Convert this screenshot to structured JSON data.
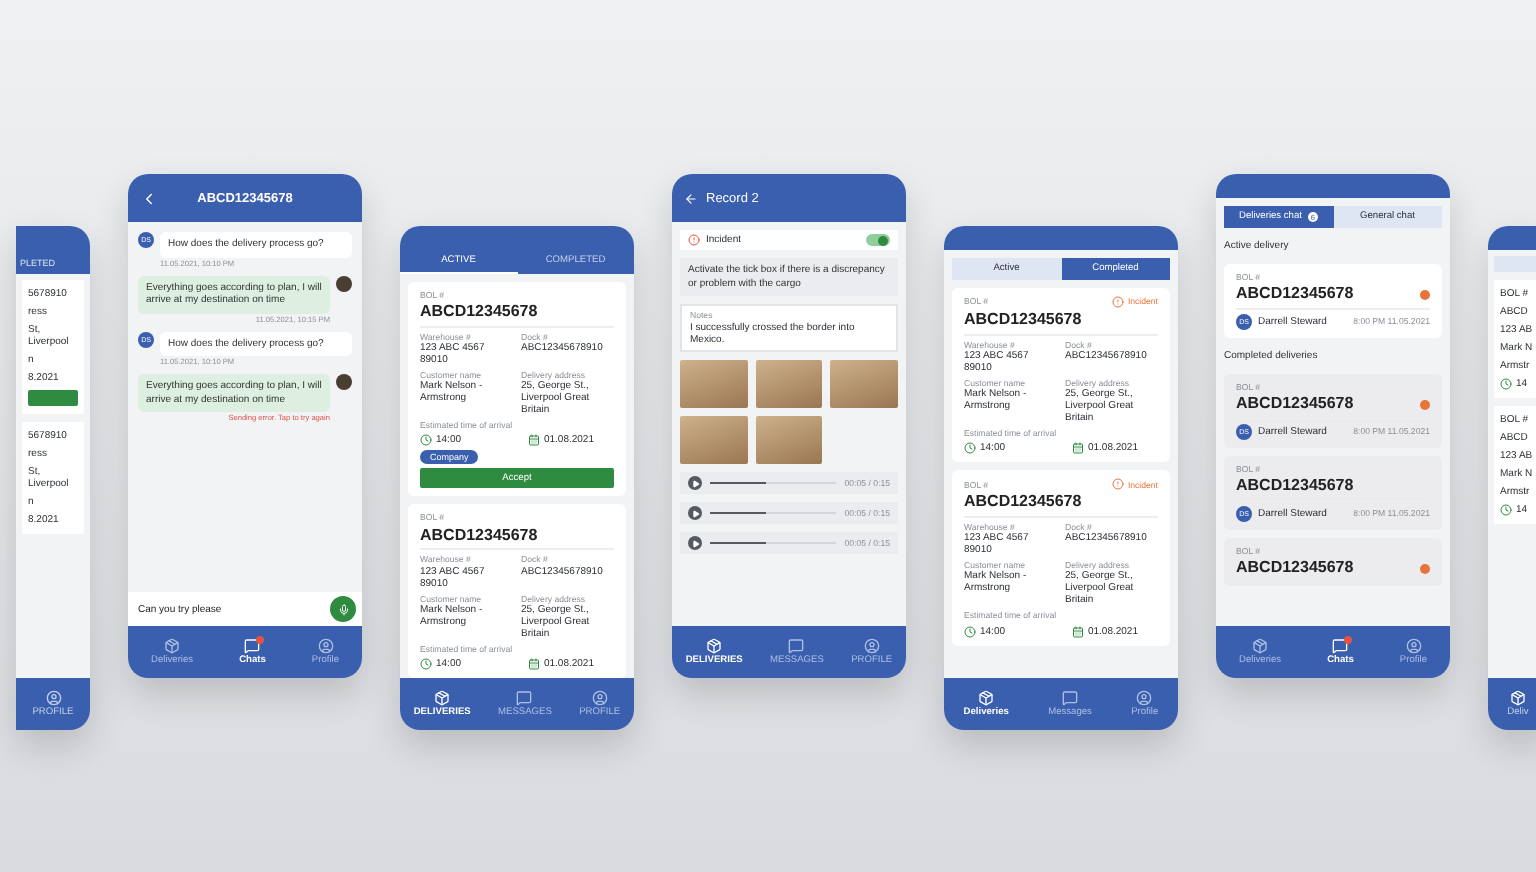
{
  "screens": [
    {
      "kind": "partial_left",
      "tab": "PLETED",
      "cards": [
        {
          "lines": [
            "5678910",
            "ress",
            "St, Liverpool",
            "n",
            "8.2021"
          ],
          "button": true
        },
        {
          "lines": [
            "5678910",
            "ress",
            "St, Liverpool",
            "n",
            "8.2021"
          ],
          "button": false
        }
      ],
      "nav_label": "PROFILE"
    },
    {
      "kind": "chat",
      "title": "ABCD12345678",
      "messages": [
        {
          "kind": "incoming",
          "initials": "DS",
          "text": "How does the delivery process go?",
          "time": "11.05.2021, 10:10 PM",
          "error": false
        },
        {
          "kind": "outgoing",
          "text": "Everything goes according to plan, I will arrive at my destination on time",
          "time": "11.05.2021, 10:15 PM",
          "error": false
        },
        {
          "kind": "incoming",
          "initials": "DS",
          "text": "How does the delivery process go?",
          "time": "11.05.2021, 10:10 PM",
          "error": false
        },
        {
          "kind": "outgoing",
          "text": "Everything goes according to plan, I will arrive at my destination on time",
          "time": "Sending error. Tap to try again",
          "error": true
        }
      ],
      "input": "Can you try please",
      "nav": [
        {
          "label": "Deliveries",
          "selected": false,
          "badge": false
        },
        {
          "label": "Chats",
          "selected": true,
          "badge": true
        },
        {
          "label": "Profile",
          "selected": false,
          "badge": false
        }
      ]
    },
    {
      "kind": "deliveries",
      "tabs": [
        {
          "label": "ACTIVE",
          "selected": true
        },
        {
          "label": "COMPLETED",
          "selected": false
        }
      ],
      "cards": [
        {
          "bol_label": "BOL #",
          "bol": "ABCD12345678",
          "fields": [
            {
              "label": "Warehouse #",
              "value": "123 ABC 4567 89010"
            },
            {
              "label": "Dock #",
              "value": "ABC12345678910"
            },
            {
              "label": "Customer name",
              "value": "Mark Nelson - Armstrong"
            },
            {
              "label": "Delivery address",
              "value": "25, George St., Liverpool Great Britain"
            }
          ],
          "eta_label": "Estimated time of arrival",
          "time": "14:00",
          "date": "01.08.2021",
          "tag": "Company",
          "button": "Accept"
        },
        {
          "bol_label": "BOL #",
          "bol": "ABCD12345678",
          "fields": [
            {
              "label": "Warehouse #",
              "value": "123 ABC 4567 89010"
            },
            {
              "label": "Dock #",
              "value": "ABC12345678910"
            },
            {
              "label": "Customer name",
              "value": "Mark Nelson - Armstrong"
            },
            {
              "label": "Delivery address",
              "value": "25, George St., Liverpool Great Britain"
            }
          ],
          "eta_label": "Estimated time of arrival",
          "time": "14:00",
          "date": "01.08.2021"
        }
      ],
      "nav": [
        {
          "label": "DELIVERIES",
          "selected": true,
          "badge": false
        },
        {
          "label": "MESSAGES",
          "selected": false,
          "badge": false
        },
        {
          "label": "PROFILE",
          "selected": false,
          "badge": false
        }
      ]
    },
    {
      "kind": "record",
      "title": "Record 2",
      "incident": {
        "label": "Incident",
        "on": true
      },
      "hint": "Activate the tick box if there is a discrepancy or problem with the cargo",
      "notes": {
        "label": "Notes",
        "value": "I successfully crossed the border into Mexico."
      },
      "audio": [
        {
          "level": 0.45,
          "time": "00:05 / 0:15"
        },
        {
          "level": 0.45,
          "time": "00:05 / 0:15"
        },
        {
          "level": 0.45,
          "time": "00:05 / 0:15"
        }
      ],
      "nav": [
        {
          "label": "DELIVERIES",
          "selected": true,
          "badge": false
        },
        {
          "label": "MESSAGES",
          "selected": false,
          "badge": false
        },
        {
          "label": "PROFILE",
          "selected": false,
          "badge": false
        }
      ]
    },
    {
      "kind": "completed",
      "segments": [
        {
          "label": "Active",
          "selected": false
        },
        {
          "label": "Completed",
          "selected": true
        }
      ],
      "cards": [
        {
          "bol_label": "BOL #",
          "bol": "ABCD12345678",
          "incident": "Incident",
          "fields": [
            {
              "label": "Warehouse #",
              "value": "123 ABC 4567 89010"
            },
            {
              "label": "Dock #",
              "value": "ABC12345678910"
            },
            {
              "label": "Customer name",
              "value": "Mark Nelson - Armstrong"
            },
            {
              "label": "Delivery address",
              "value": "25, George St., Liverpool Great Britain"
            }
          ],
          "eta_label": "Estimated time of arrival",
          "time": "14:00",
          "date": "01.08.2021"
        },
        {
          "bol_label": "BOL #",
          "bol": "ABCD12345678",
          "incident": "Incident",
          "fields": [
            {
              "label": "Warehouse #",
              "value": "123 ABC 4567 89010"
            },
            {
              "label": "Dock #",
              "value": "ABC12345678910"
            },
            {
              "label": "Customer name",
              "value": "Mark Nelson - Armstrong"
            },
            {
              "label": "Delivery address",
              "value": "25, George St., Liverpool Great Britain"
            }
          ],
          "eta_label": "Estimated time of arrival",
          "time": "14:00",
          "date": "01.08.2021"
        }
      ],
      "nav": [
        {
          "label": "Deliveries",
          "selected": true,
          "badge": false
        },
        {
          "label": "Messages",
          "selected": false,
          "badge": false
        },
        {
          "label": "Profile",
          "selected": false,
          "badge": false
        }
      ]
    },
    {
      "kind": "chat_list",
      "segments": [
        {
          "label": "Deliveries chat",
          "count": "6",
          "selected": true
        },
        {
          "label": "General chat",
          "selected": false
        }
      ],
      "sections": [
        {
          "title": "Active delivery",
          "cards": [
            {
              "bol_label": "BOL #",
              "bol": "ABCD12345678",
              "unread": true,
              "initials": "DS",
              "name": "Darrell Steward",
              "time": "8:00 PM 11.05.2021"
            }
          ]
        },
        {
          "title": "Completed deliveries",
          "cards": [
            {
              "bol_label": "BOL #",
              "bol": "ABCD12345678",
              "unread": true,
              "initials": "DS",
              "name": "Darrell Steward",
              "time": "8:00 PM 11.05.2021"
            },
            {
              "bol_label": "BOL #",
              "bol": "ABCD12345678",
              "unread": false,
              "initials": "DS",
              "name": "Darrell Steward",
              "time": "8:00 PM 11.05.2021"
            },
            {
              "bol_label": "BOL #",
              "bol": "ABCD12345678",
              "unread": true
            }
          ]
        }
      ],
      "nav": [
        {
          "label": "Deliveries",
          "selected": false,
          "badge": false
        },
        {
          "label": "Chats",
          "selected": true,
          "badge": true
        },
        {
          "label": "Profile",
          "selected": false,
          "badge": false
        }
      ]
    },
    {
      "kind": "partial_right",
      "cards": [
        {
          "lines": [
            "BOL #",
            "ABCD",
            "123 AB",
            "Mark N",
            "Armstr"
          ],
          "time": "14"
        },
        {
          "lines": [
            "BOL #",
            "ABCD",
            "123 AB",
            "Mark N",
            "Armstr"
          ],
          "time": "14"
        }
      ],
      "nav_label": "Deliv"
    }
  ]
}
